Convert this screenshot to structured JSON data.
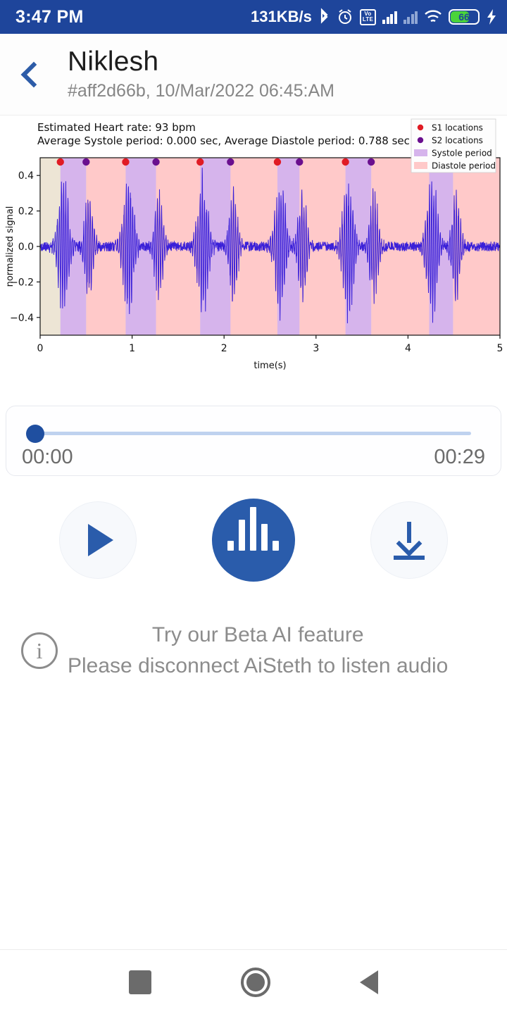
{
  "statusbar": {
    "time": "3:47 PM",
    "network_speed": "131KB/s",
    "bluetooth_icon": "bluetooth-icon",
    "alarm_icon": "alarm-icon",
    "volte_top": "Vo",
    "volte_bottom": "LTE",
    "wifi_icon": "wifi-icon",
    "battery_level": "66",
    "charging_icon": "charging-bolt-icon"
  },
  "appbar": {
    "back_icon": "back-chevron-icon",
    "title": "Niklesh",
    "subtitle": "#aff2d66b, 10/Mar/2022 06:45:AM"
  },
  "chart_data": {
    "type": "line",
    "title": "",
    "annotations": [
      "Estimated Heart rate:  93 bpm",
      "Average Systole period: 0.000 sec, Average Diastole period: 0.788 sec"
    ],
    "heart_rate_bpm": 93,
    "average_systole_period_sec": 0.0,
    "average_diastole_period_sec": 0.788,
    "xlabel": "time(s)",
    "ylabel": "normalized signal",
    "xlim": [
      0,
      5
    ],
    "ylim": [
      -0.5,
      0.5
    ],
    "xticks": [
      "0",
      "1",
      "2",
      "3",
      "4",
      "5"
    ],
    "xtick_values": [
      0,
      1,
      2,
      3,
      4,
      5
    ],
    "yticks": [
      "0.4",
      "0.2",
      "0.0",
      "-0.2",
      "-0.4"
    ],
    "ytick_values": [
      0.4,
      0.2,
      0.0,
      -0.2,
      -0.4
    ],
    "grid": false,
    "legend_position": "upper right",
    "legend": [
      {
        "label": "S1 locations",
        "color": "#e01b24",
        "marker": "dot"
      },
      {
        "label": "S2 locations",
        "color": "#6a0f8e",
        "marker": "dot"
      },
      {
        "label": "Systole period",
        "color": "#d6b4ec",
        "marker": "patch"
      },
      {
        "label": "Diastole period",
        "color": "#ffc9c9",
        "marker": "patch"
      }
    ],
    "signal_color": "#3a20d8",
    "background_color": "#ede5d5",
    "s1_locations": [
      0.22,
      0.93,
      1.74,
      2.58,
      3.32,
      4.23
    ],
    "s2_locations": [
      0.5,
      1.26,
      2.07,
      2.82,
      3.6,
      4.49
    ],
    "systole_bands": [
      [
        0.22,
        0.5
      ],
      [
        0.93,
        1.26
      ],
      [
        1.74,
        2.07
      ],
      [
        2.58,
        2.82
      ],
      [
        3.32,
        3.6
      ],
      [
        4.23,
        4.49
      ]
    ],
    "diastole_bands": [
      [
        0.5,
        0.93
      ],
      [
        1.26,
        1.74
      ],
      [
        2.07,
        2.58
      ],
      [
        2.82,
        3.32
      ],
      [
        3.6,
        4.23
      ],
      [
        4.49,
        5.0
      ]
    ]
  },
  "player": {
    "current_time": "00:00",
    "total_time": "00:29",
    "progress_percent": 0
  },
  "controls": {
    "play_label": "play-button",
    "analyze_label": "waveform-button",
    "download_label": "download-button"
  },
  "info": {
    "icon_glyph": "i",
    "line1": "Try our Beta AI feature",
    "line2": "Please disconnect AiSteth to listen audio"
  },
  "navbar": {
    "recents": "recents-button",
    "home": "home-button",
    "back": "back-button"
  }
}
